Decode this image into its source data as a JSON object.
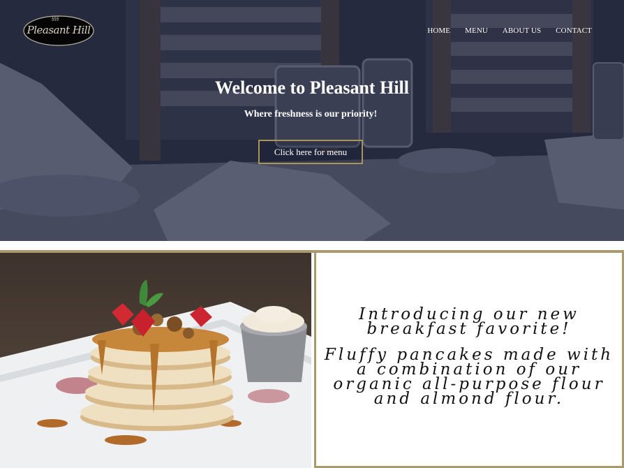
{
  "brand": {
    "logo_text": "Pleasant Hill"
  },
  "nav": {
    "items": [
      {
        "label": "HOME"
      },
      {
        "label": "MENU"
      },
      {
        "label": "ABOUT US"
      },
      {
        "label": "CONTACT"
      }
    ]
  },
  "hero": {
    "title": "Welcome to Pleasant Hill",
    "subtitle": "Where freshness is our priority!",
    "button_label": "Click here for menu"
  },
  "feature": {
    "heading": "Introducing our new breakfast favorite!",
    "body": "Fluffy pancakes made with a combination of our organic all-purpose flour and almond flour."
  },
  "colors": {
    "accent_gold": "#a89a6c",
    "hero_overlay": "#2c3146",
    "text_light": "#ffffff"
  }
}
